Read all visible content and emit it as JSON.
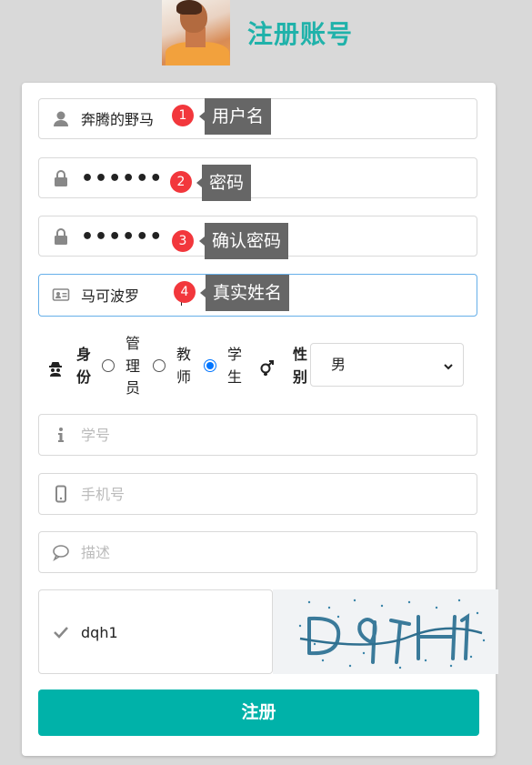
{
  "header": {
    "title": "注册账号"
  },
  "form": {
    "username": {
      "value": "奔腾的野马",
      "step": "1",
      "tip": "用户名"
    },
    "password": {
      "value": "••••••",
      "step": "2",
      "tip": "密码"
    },
    "confirm_password": {
      "value": "••••••",
      "step": "3",
      "tip": "确认密码"
    },
    "real_name": {
      "value": "马可波罗",
      "step": "4",
      "tip": "真实姓名"
    },
    "identity": {
      "label_1": "身",
      "label_2": "份",
      "options": [
        {
          "c1": "管",
          "c2": "理",
          "c3": "员",
          "checked": false
        },
        {
          "c1": "教",
          "c2": "师",
          "checked": false
        },
        {
          "c1": "学",
          "c2": "生",
          "checked": true
        }
      ]
    },
    "gender": {
      "label_1": "性",
      "label_2": "别",
      "selected": "男"
    },
    "student_id": {
      "placeholder": "学号"
    },
    "phone": {
      "placeholder": "手机号"
    },
    "description": {
      "placeholder": "描述"
    },
    "captcha": {
      "value": "dqh1"
    },
    "submit_label": "注册"
  },
  "colors": {
    "accent": "#00b2a9",
    "title": "#20b2aa",
    "badge": "#f2373c",
    "tip": "#666666"
  }
}
